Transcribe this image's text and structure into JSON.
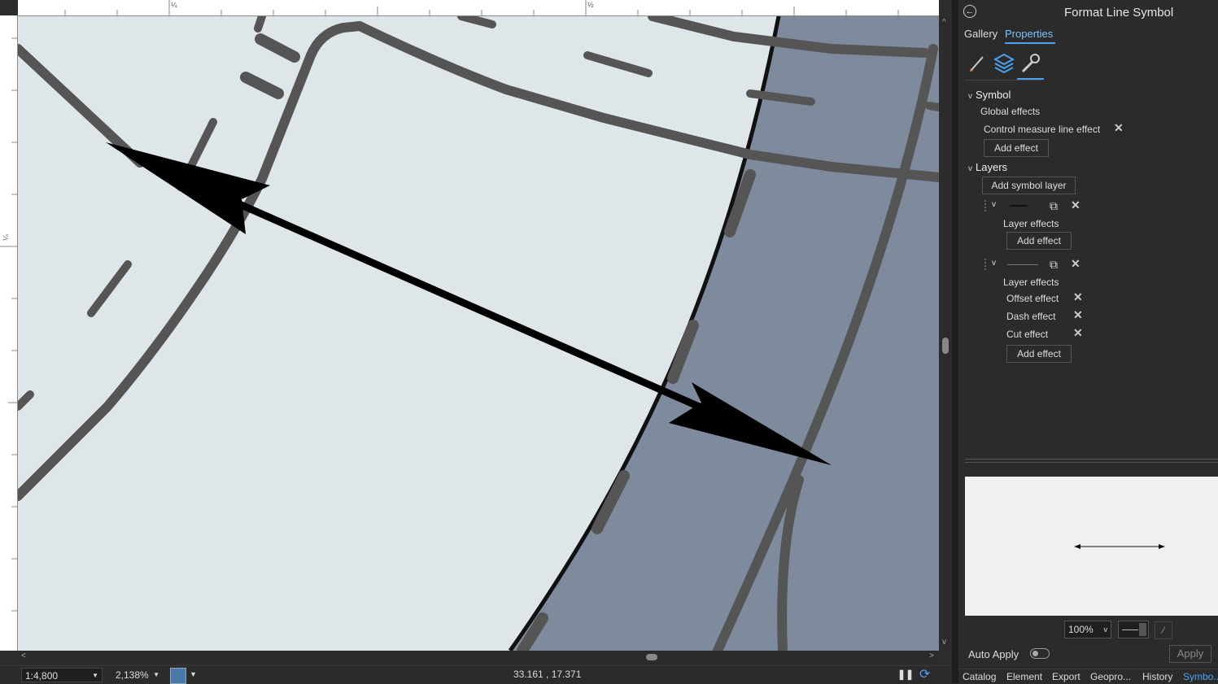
{
  "ruler": {
    "top_marks": [
      "¼",
      "½"
    ],
    "left_marks": [
      "¼"
    ]
  },
  "status": {
    "scale": "1:4,800",
    "zoom": "2,138%",
    "coordinates": "33.161 , 17.371"
  },
  "pane": {
    "title": "Format Line Symbol",
    "tabs": [
      {
        "label": "Gallery"
      },
      {
        "label": "Properties"
      }
    ],
    "symbol": {
      "heading": "Symbol",
      "global_effects_label": "Global effects",
      "effect_item": "Control measure line effect",
      "add_effect": "Add effect"
    },
    "layers": {
      "heading": "Layers",
      "add_symbol_layer": "Add symbol layer",
      "layer1": {
        "effects_label": "Layer effects",
        "add_effect": "Add effect"
      },
      "layer2": {
        "effects_label": "Layer effects",
        "effects": [
          "Offset effect",
          "Dash effect",
          "Cut effect"
        ],
        "add_effect": "Add effect"
      }
    },
    "preview_zoom": "100%",
    "auto_apply_label": "Auto Apply",
    "apply_label": "Apply"
  },
  "bottom_tabs": [
    "Catalog",
    "Element",
    "Export",
    "Geopro...",
    "History",
    "Symbo..."
  ],
  "colors": {
    "accent": "#4aa3f0",
    "water": "#7d8b9c",
    "land": "#dfe6ea",
    "road": "#555555"
  }
}
